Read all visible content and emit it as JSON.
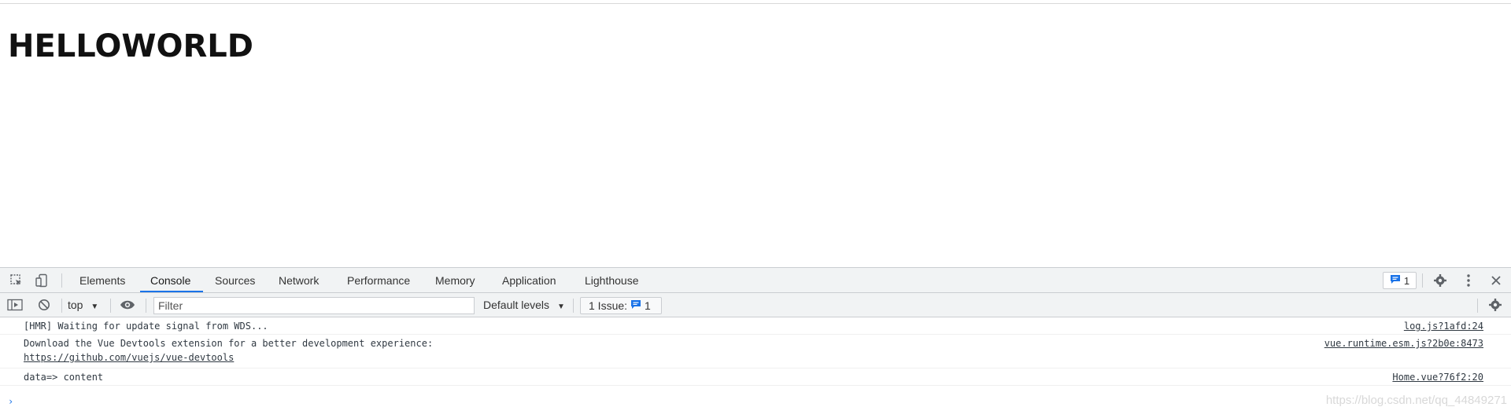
{
  "page": {
    "heading": "HELLOWORLD"
  },
  "devtools": {
    "tabs": [
      {
        "label": "Elements"
      },
      {
        "label": "Console",
        "active": true
      },
      {
        "label": "Sources"
      },
      {
        "label": "Network"
      },
      {
        "label": "Performance"
      },
      {
        "label": "Memory"
      },
      {
        "label": "Application"
      },
      {
        "label": "Lighthouse"
      }
    ],
    "issues_badge": "1",
    "toolbar": {
      "context": "top",
      "filter_placeholder": "Filter",
      "levels": "Default levels",
      "issue_counter_label": "1 Issue:",
      "issue_counter_count": "1"
    },
    "messages": [
      {
        "text": "[HMR] Waiting for update signal from WDS...",
        "source": "log.js?1afd:24"
      },
      {
        "text": "Download the Vue Devtools extension for a better development experience:",
        "link": "https://github.com/vuejs/vue-devtools",
        "source": "vue.runtime.esm.js?2b0e:8473"
      },
      {
        "text": "data=> content",
        "source": "Home.vue?76f2:20"
      }
    ],
    "prompt_symbol": "›"
  },
  "watermark": "https://blog.csdn.net/qq_44849271",
  "colors": {
    "accent": "#1a73e8",
    "toolbar_bg": "#f1f3f4",
    "border": "#cacdd1"
  }
}
